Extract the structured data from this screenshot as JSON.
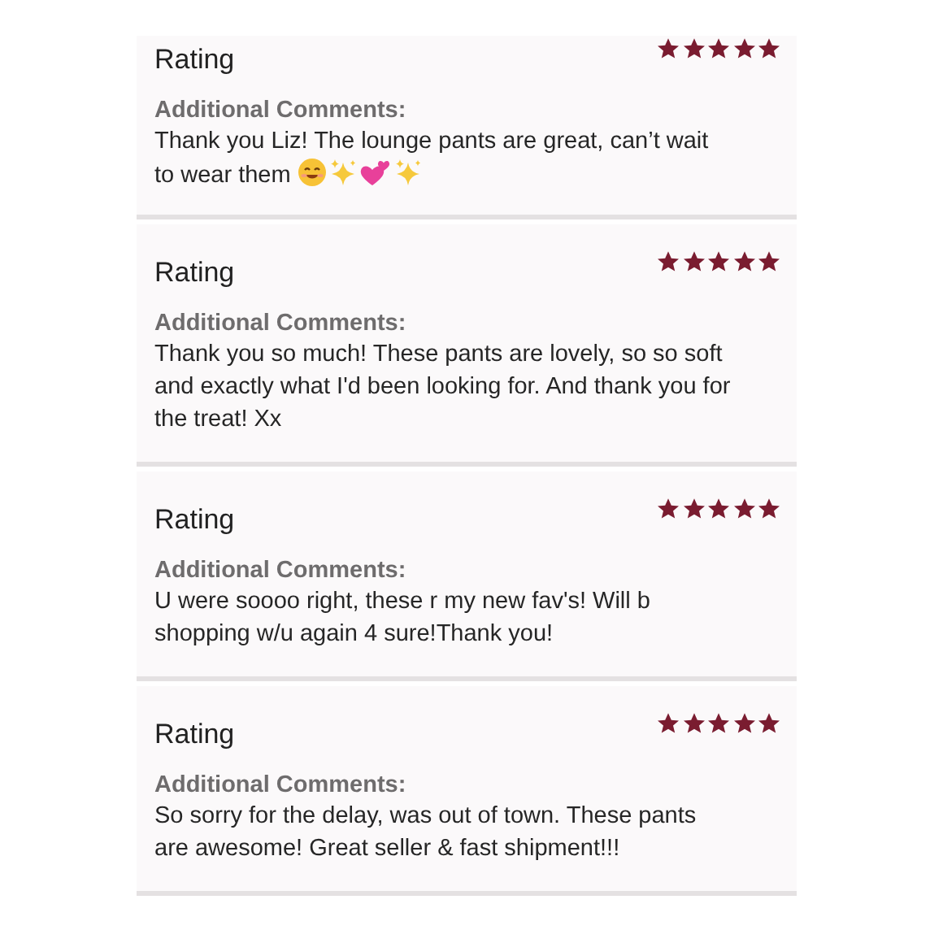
{
  "reviews": [
    {
      "heading": "Rating",
      "stars": 5,
      "label": "Additional Comments:",
      "comment": "Thank you Liz! The lounge pants are great, can’t wait to wear them",
      "icons": [
        {
          "kind": "smile"
        },
        {
          "kind": "sparkles"
        },
        {
          "kind": "hearts"
        },
        {
          "kind": "sparkles"
        }
      ]
    },
    {
      "heading": "Rating",
      "stars": 5,
      "label": "Additional Comments:",
      "comment": "Thank you so much! These pants are lovely, so so soft and exactly what I'd been looking for. And thank you for the treat! Xx"
    },
    {
      "heading": "Rating",
      "stars": 5,
      "label": "Additional Comments:",
      "comment": "U were soooo right, these r my new fav's! Will b shopping w/u again 4 sure!Thank you!"
    },
    {
      "heading": "Rating",
      "stars": 5,
      "label": "Additional Comments:",
      "comment": "So sorry for the delay, was out of town. These pants are awesome! Great seller & fast shipment!!!"
    }
  ]
}
